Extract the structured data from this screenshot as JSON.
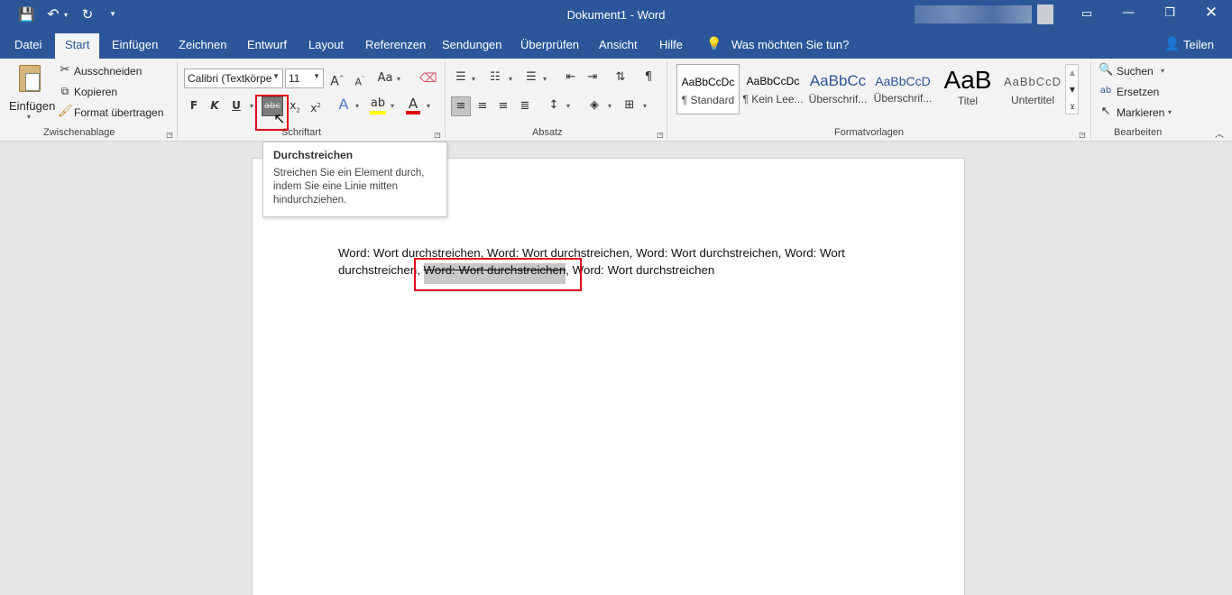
{
  "window": {
    "title": "Dokument1 - Word",
    "user_name_blurred": ""
  },
  "quick_access": {
    "icons": [
      "save-icon",
      "undo-icon",
      "redo-icon",
      "customize-icon"
    ]
  },
  "tabs": [
    {
      "label": "Datei"
    },
    {
      "label": "Start"
    },
    {
      "label": "Einfügen"
    },
    {
      "label": "Zeichnen"
    },
    {
      "label": "Entwurf"
    },
    {
      "label": "Layout"
    },
    {
      "label": "Referenzen"
    },
    {
      "label": "Sendungen"
    },
    {
      "label": "Überprüfen"
    },
    {
      "label": "Ansicht"
    },
    {
      "label": "Hilfe"
    }
  ],
  "tell_me": "Was möchten Sie tun?",
  "share": "Teilen",
  "clipboard": {
    "paste": "Einfügen",
    "cut": "Ausschneiden",
    "copy": "Kopieren",
    "format_painter": "Format übertragen",
    "group": "Zwischenablage"
  },
  "font": {
    "family": "Calibri (Textkörpe",
    "size": "11",
    "group": "Schriftart",
    "bold": "F",
    "italic": "K",
    "underline": "U",
    "strike": "abc",
    "case": "Aa"
  },
  "paragraph": {
    "group": "Absatz"
  },
  "styles": {
    "items": [
      {
        "preview": "AaBbCcDc",
        "name": "¶ Standard"
      },
      {
        "preview": "AaBbCcDc",
        "name": "¶ Kein Lee..."
      },
      {
        "preview": "AaBbCc",
        "name": "Überschrif..."
      },
      {
        "preview": "AaBbCcD",
        "name": "Überschrif..."
      },
      {
        "preview": "AaB",
        "name": "Titel"
      },
      {
        "preview": "AaBbCcD",
        "name": "Untertitel"
      }
    ],
    "group": "Formatvorlagen"
  },
  "editing": {
    "find": "Suchen",
    "replace": "Ersetzen",
    "select": "Markieren",
    "group": "Bearbeiten"
  },
  "tooltip": {
    "title": "Durchstreichen",
    "body_line1": "Streichen Sie ein Element durch,",
    "body_line2": "indem Sie eine Linie mitten",
    "body_line3": "hindurchziehen."
  },
  "document": {
    "line1": "Word: Wort durchstreichen, Word: Wort durchstreichen, Word: Wort durchstreichen, Word: Wort",
    "line2_a": "durchstreichen, ",
    "line2_struck": "Word: Wort durchstreichen",
    "line2_b": ", Word: Wort durchstreichen"
  },
  "colors": {
    "ribbon_blue": "#2b579a",
    "highlight_color": "#ffff00",
    "font_color": "#e00000",
    "annotation_red": "#e0001b",
    "selection_gray": "#c8c8c8"
  }
}
